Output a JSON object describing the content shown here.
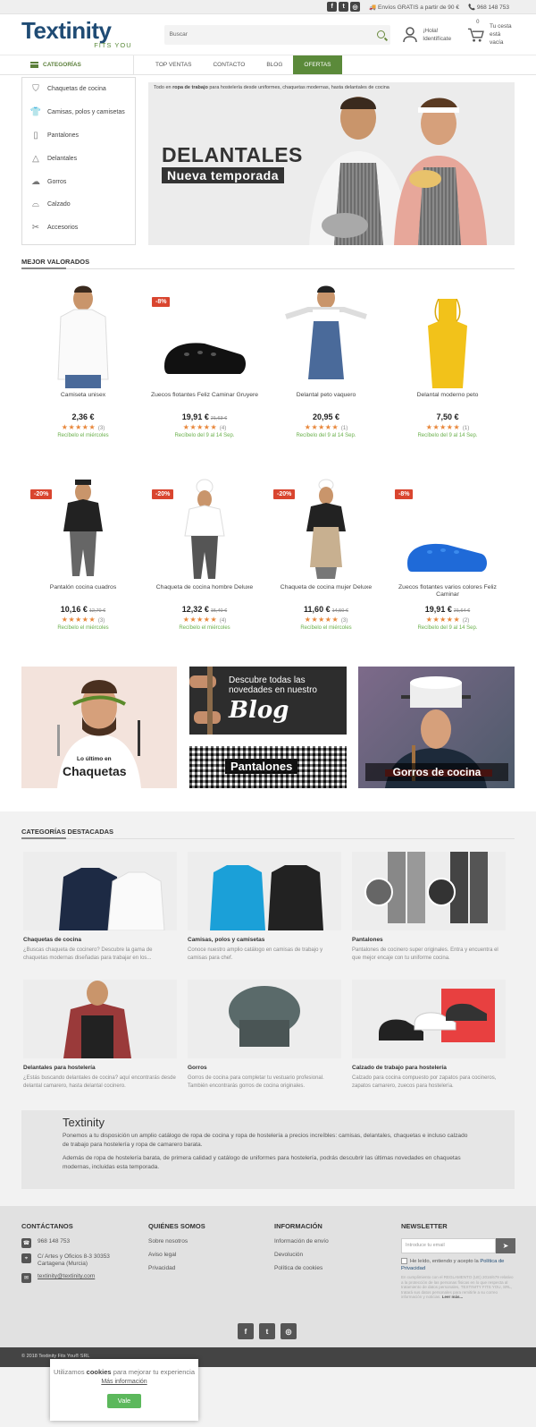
{
  "topbar": {
    "social": [
      "f",
      "t",
      "ig"
    ],
    "shipping": "Envíos GRATIS a partir de 90 €",
    "phone": "968 148 753"
  },
  "header": {
    "logo_main": "Textinity",
    "logo_sub": "FITS YOU",
    "search_placeholder": "Buscar",
    "account_line1": "¡Hola!",
    "account_line2": "Identifícate",
    "cart_count": "0",
    "cart_line1": "Tu cesta",
    "cart_line2": "está vacía"
  },
  "nav": {
    "categories_label": "CATEGORÍAS",
    "items": [
      "TOP VENTAS",
      "CONTACTO",
      "BLOG",
      "OFERTAS"
    ]
  },
  "sidemenu": [
    {
      "label": "Chaquetas de cocina",
      "icon": "jacket-icon"
    },
    {
      "label": "Camisas, polos y camisetas",
      "icon": "shirt-icon"
    },
    {
      "label": "Pantalones",
      "icon": "pants-icon"
    },
    {
      "label": "Delantales",
      "icon": "apron-icon"
    },
    {
      "label": "Gorros",
      "icon": "hat-icon"
    },
    {
      "label": "Calzado",
      "icon": "shoe-icon"
    },
    {
      "label": "Accesorios",
      "icon": "accessories-icon"
    }
  ],
  "hero": {
    "intro_pre": "Todo en ",
    "intro_bold": "ropa de trabajo",
    "intro_post": " para hostelería desde uniformes, chaquetas modernas, hasta delantales de cocina",
    "title": "DELANTALES",
    "subtitle": "Nueva temporada"
  },
  "best_rated": {
    "title": "MEJOR VALORADOS",
    "products": [
      {
        "name": "Camiseta unisex",
        "price": "2,36 €",
        "old": "",
        "badge": "",
        "reviews": "(3)",
        "ship": "Recíbelo el miércoles"
      },
      {
        "name": "Zuecos flotantes Feliz Caminar Gruyere",
        "price": "19,91 €",
        "old": "21,63 €",
        "badge": "-8%",
        "reviews": "(4)",
        "ship": "Recíbelo del 9 al 14 Sep."
      },
      {
        "name": "Delantal peto vaquero",
        "price": "20,95 €",
        "old": "",
        "badge": "",
        "reviews": "(1)",
        "ship": "Recíbelo del 9 al 14 Sep."
      },
      {
        "name": "Delantal moderno peto",
        "price": "7,50 €",
        "old": "",
        "badge": "",
        "reviews": "(1)",
        "ship": "Recíbelo del 9 al 14 Sep."
      },
      {
        "name": "Pantalón cocina cuadros",
        "price": "10,16 €",
        "old": "12,70 €",
        "badge": "-20%",
        "reviews": "(3)",
        "ship": "Recíbelo el miércoles"
      },
      {
        "name": "Chaqueta de cocina hombre Deluxe",
        "price": "12,32 €",
        "old": "15,40 €",
        "badge": "-20%",
        "reviews": "(4)",
        "ship": "Recíbelo el miércoles"
      },
      {
        "name": "Chaqueta de cocina mujer Deluxe",
        "price": "11,60 €",
        "old": "14,50 €",
        "badge": "-20%",
        "reviews": "(3)",
        "ship": "Recíbelo el miércoles"
      },
      {
        "name": "Zuecos flotantes varios colores Feliz Caminar",
        "price": "19,91 €",
        "old": "21,64 €",
        "badge": "-8%",
        "reviews": "(2)",
        "ship": "Recíbelo del 9 al 14 Sep."
      }
    ]
  },
  "banners": {
    "chaquetas_pre": "Lo último en",
    "chaquetas": "Chaquetas",
    "blog_text": "Descubre todas las novedades en nuestro",
    "blog_word": "Blog",
    "pantalones": "Pantalones",
    "gorros": "Gorros de cocina"
  },
  "featured": {
    "title": "CATEGORÍAS DESTACADAS",
    "cards": [
      {
        "title": "Chaquetas de cocina",
        "desc": "¿Buscas chaqueta de cocinero? Descubre la gama de chaquetas modernas diseñadas para trabajar en los..."
      },
      {
        "title": "Camisas, polos y camisetas",
        "desc": "Conoce nuestro amplio catálogo en camisas de trabajo y camisas para chef."
      },
      {
        "title": "Pantalones",
        "desc": "Pantalones de cocinero super originales. Entra y encuentra el que mejor encaje con tu uniforme cocina."
      },
      {
        "title": "Delantales para hostelería",
        "desc": "¿Estás buscando delantales de cocina? aquí encontrarás desde delantal camarero, hasta delantal cocinero."
      },
      {
        "title": "Gorros",
        "desc": "Gorros de cocina para completar tu vestuario profesional. También encontrarás gorros de cocina originales."
      },
      {
        "title": "Calzado de trabajo para hostelería",
        "desc": "Calzado para cocina compuesto por zapatos para cocineros, zapatos camarero, zuecos para hostelería."
      }
    ]
  },
  "about": {
    "title": "Textinity",
    "p1": "Ponemos a tu disposición un amplio catálogo de ropa de cocina y ropa de hostelería a precios increíbles: camisas, delantales, chaquetas e incluso calzado de trabajo para hostelería y ropa de camarero barata.",
    "p2": "Además de ropa de hostelería barata, de primera calidad y catálogo de uniformes para hostelería, podrás descubrir las últimas novedades en chaquetas modernas, incluidas esta temporada."
  },
  "footer": {
    "contact_title": "CONTÁCTANOS",
    "phone": "968 148 753",
    "address": "C/ Artes y Oficios 8-3 30353 Cartagena (Murcia)",
    "email": "textinity@textinity.com",
    "about_title": "QUIÉNES SOMOS",
    "about_links": [
      "Sobre nosotros",
      "Aviso legal",
      "Privacidad"
    ],
    "info_title": "INFORMACIÓN",
    "info_links": [
      "Información de envío",
      "Devolución",
      "Política de cookies"
    ],
    "newsletter_title": "NEWSLETTER",
    "newsletter_placeholder": "Introduce tu email",
    "accept_text": "He leído, entiendo y acepto la",
    "privacy_link": "Política de Privacidad",
    "legal": "En cumplimiento con el REGLAMENTO (UE) 2016/679 relativo a la protección de las personas físicas en lo que respecta al tratamiento de datos personales, TEXTINITY FITS YOU, SRL, tratará sus datos personales para remitirle a su correo información y noticias.",
    "legal_more": "Leer más...",
    "copyright": "© 2018 Textinity Fits You® SRL"
  },
  "cookie": {
    "pre": "Utilizamos ",
    "bold": "cookies",
    "post": " para mejorar tu experiencia ",
    "link": "Más información",
    "button": "Vale"
  },
  "colors": {
    "brand": "#1f4b74",
    "accent": "#5b8a3a",
    "sale": "#d9452f",
    "stars": "#e8873b"
  }
}
